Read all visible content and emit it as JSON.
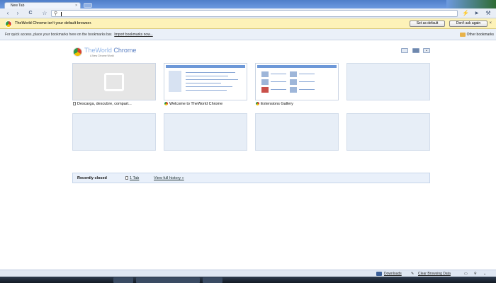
{
  "tab": {
    "title": "New Tab",
    "close": "×"
  },
  "toolbar": {
    "back": "‹",
    "forward": "›",
    "reload": "C",
    "star": "☆",
    "search_icon": "search-icon"
  },
  "infobar": {
    "message": "TheWorld Chrome isn't your default browser.",
    "set_default": "Set as default",
    "dont_ask": "Don't ask again",
    "close": "×"
  },
  "bookmarks": {
    "hint": "For quick access, place your bookmarks here on the bookmarks bar.",
    "import_link": "Import bookmarks now...",
    "other": "Other bookmarks"
  },
  "logo": {
    "name_main": "TheWorld",
    "name_rest": " Chrome",
    "tagline": "A New Chrome World"
  },
  "thumbnails": [
    {
      "title": "Descarga, descubre, compart..."
    },
    {
      "title": "Welcome to TheWorld Chrome"
    },
    {
      "title": "Extensions Gallery"
    }
  ],
  "recently_closed": {
    "label": "Recently closed",
    "tab": "1 Tab",
    "history": "View full history »"
  },
  "status": {
    "downloads": "Downloads",
    "clear": "Clear Browsing Data"
  },
  "colors": {
    "tabstrip": "#5a86cf",
    "infobar": "#fdf2b8",
    "thumb_empty": "#e7eef7"
  }
}
